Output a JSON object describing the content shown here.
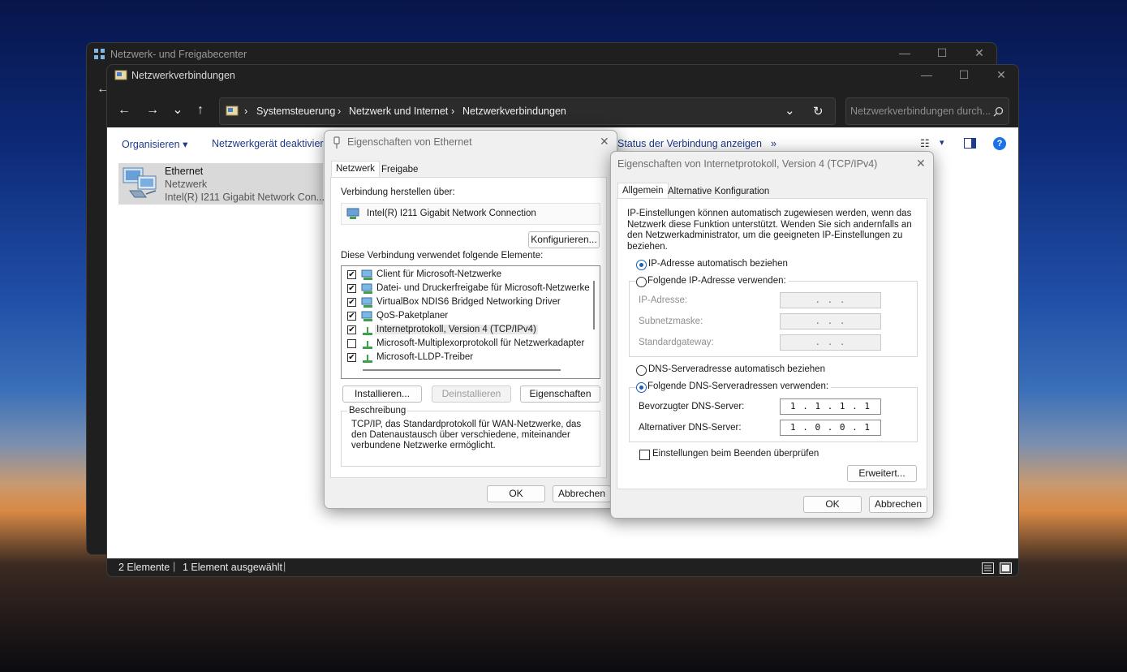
{
  "colors": {
    "accent": "#1a5fb4",
    "link": "#1e3a8a",
    "dark_chrome": "#202020"
  },
  "nfc_window": {
    "title": "Netzwerk- und Freigabecenter",
    "icon": "network-center-icon"
  },
  "nv_window": {
    "title": "Netzwerkverbindungen",
    "icon": "network-connections-icon",
    "nav": {
      "back": "←",
      "forward": "→",
      "recent": "⌄",
      "up": "↑"
    },
    "breadcrumb": [
      "Systemsteuerung",
      "Netzwerk und Internet",
      "Netzwerkverbindungen"
    ],
    "breadcrumb_sep": "›",
    "search_placeholder": "Netzwerkverbindungen durch...",
    "commands": {
      "organize": "Organisieren",
      "deactivate": "Netzwerkgerät deaktivieren",
      "status": "Status der Verbindung anzeigen",
      "more": "»"
    },
    "item": {
      "name": "Ethernet",
      "type": "Netzwerk",
      "adapter": "Intel(R) I211 Gigabit Network Con..."
    },
    "status": {
      "count": "2 Elemente",
      "selected": "1 Element ausgewählt"
    }
  },
  "eth_dialog": {
    "title": "Eigenschaften von Ethernet",
    "tabs": [
      "Netzwerk",
      "Freigabe"
    ],
    "connect_label": "Verbindung herstellen über:",
    "adapter": "Intel(R) I211 Gigabit Network Connection",
    "configure_btn": "Konfigurieren...",
    "elements_label": "Diese Verbindung verwendet folgende Elemente:",
    "elements": [
      {
        "label": "Client für Microsoft-Netzwerke",
        "checked": true,
        "icon": "client-icon"
      },
      {
        "label": "Datei- und Druckerfreigabe für Microsoft-Netzwerke",
        "checked": true,
        "icon": "service-icon"
      },
      {
        "label": "VirtualBox NDIS6 Bridged Networking Driver",
        "checked": true,
        "icon": "service-icon"
      },
      {
        "label": "QoS-Paketplaner",
        "checked": true,
        "icon": "service-icon"
      },
      {
        "label": "Internetprotokoll, Version 4 (TCP/IPv4)",
        "checked": true,
        "icon": "protocol-icon"
      },
      {
        "label": "Microsoft-Multiplexorprotokoll für Netzwerkadapter",
        "checked": false,
        "icon": "protocol-icon"
      },
      {
        "label": "Microsoft-LLDP-Treiber",
        "checked": true,
        "icon": "protocol-icon"
      }
    ],
    "install_btn": "Installieren...",
    "uninstall_btn": "Deinstallieren",
    "properties_btn": "Eigenschaften",
    "description_title": "Beschreibung",
    "description": "TCP/IP, das Standardprotokoll für WAN-Netzwerke, das den Datenaustausch über verschiedene, miteinander verbundene Netzwerke ermöglicht.",
    "ok": "OK",
    "cancel": "Abbrechen"
  },
  "ipv4_dialog": {
    "title": "Eigenschaften von Internetprotokoll, Version 4 (TCP/IPv4)",
    "tabs": [
      "Allgemein",
      "Alternative Konfiguration"
    ],
    "intro": "IP-Einstellungen können automatisch zugewiesen werden, wenn das Netzwerk diese Funktion unterstützt. Wenden Sie sich andernfalls an den Netzwerkadministrator, um die geeigneten IP-Einstellungen zu beziehen.",
    "ip_auto": "IP-Adresse automatisch beziehen",
    "ip_manual": "Folgende IP-Adresse verwenden:",
    "ip_label": "IP-Adresse:",
    "mask_label": "Subnetzmaske:",
    "gateway_label": "Standardgateway:",
    "empty_ip": ".   .   .",
    "dns_auto": "DNS-Serveradresse automatisch beziehen",
    "dns_manual": "Folgende DNS-Serveradressen verwenden:",
    "dns_pref_label": "Bevorzugter DNS-Server:",
    "dns_alt_label": "Alternativer DNS-Server:",
    "dns_pref": "1 . 1 . 1 . 1",
    "dns_alt": "1 . 0 . 0 . 1",
    "validate": "Einstellungen beim Beenden überprüfen",
    "advanced_btn": "Erweitert...",
    "ok": "OK",
    "cancel": "Abbrechen"
  }
}
